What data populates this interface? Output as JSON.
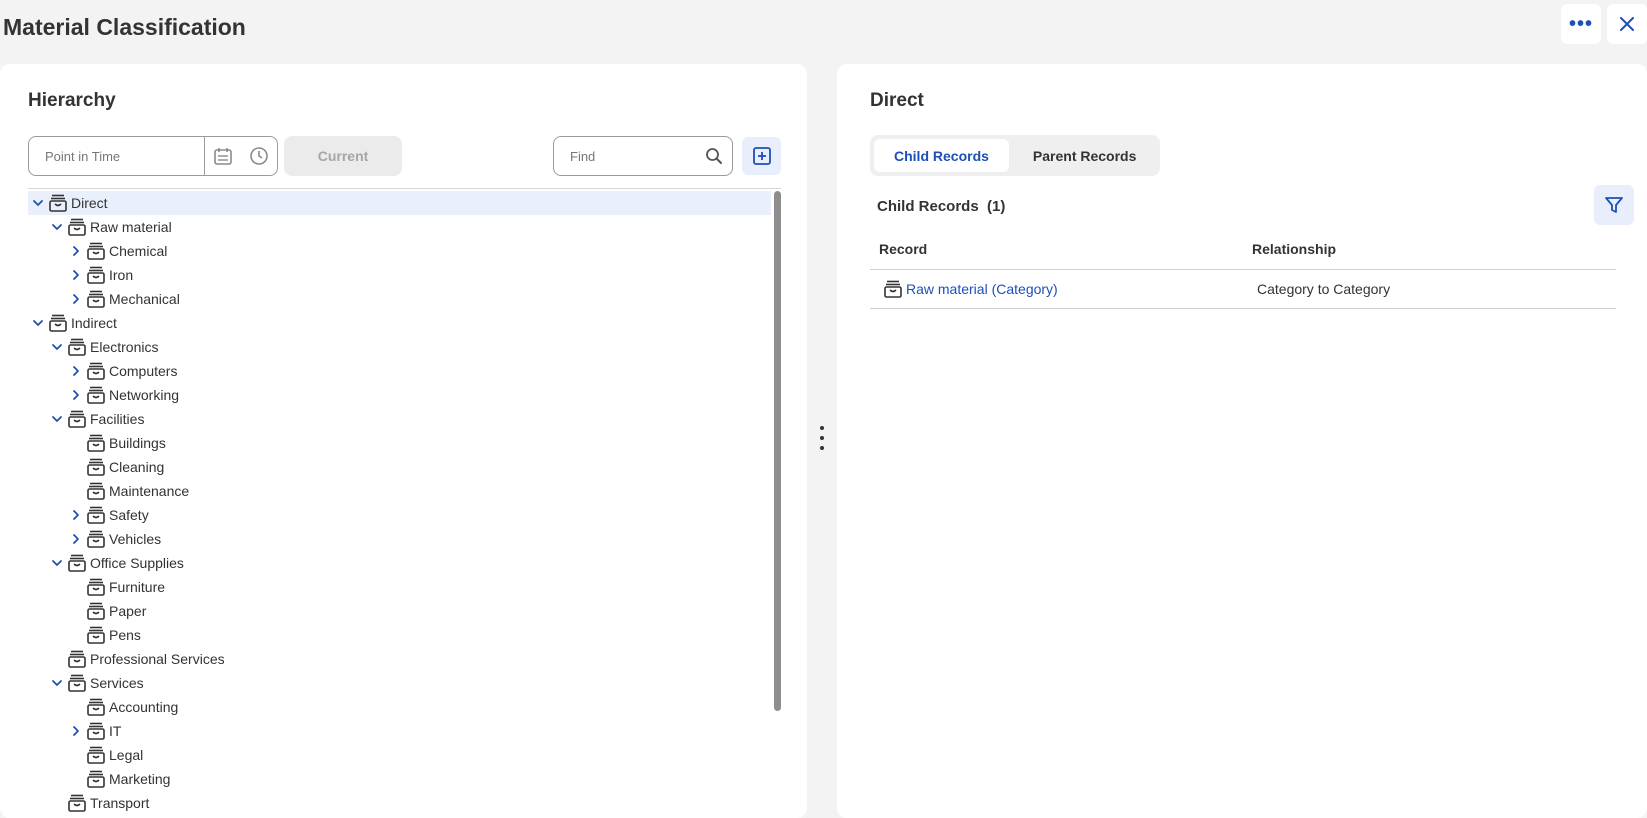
{
  "header": {
    "title": "Material Classification"
  },
  "left_panel": {
    "heading": "Hierarchy",
    "point_in_time_placeholder": "Point in Time",
    "current_label": "Current",
    "find_placeholder": "Find"
  },
  "tree": [
    {
      "label": "Direct",
      "level": 0,
      "expander": "down",
      "selected": true
    },
    {
      "label": "Raw material",
      "level": 1,
      "expander": "down"
    },
    {
      "label": "Chemical",
      "level": 2,
      "expander": "right"
    },
    {
      "label": "Iron",
      "level": 2,
      "expander": "right"
    },
    {
      "label": "Mechanical",
      "level": 2,
      "expander": "right"
    },
    {
      "label": "Indirect",
      "level": 0,
      "expander": "down"
    },
    {
      "label": "Electronics",
      "level": 1,
      "expander": "down"
    },
    {
      "label": "Computers",
      "level": 2,
      "expander": "right"
    },
    {
      "label": "Networking",
      "level": 2,
      "expander": "right"
    },
    {
      "label": "Facilities",
      "level": 1,
      "expander": "down"
    },
    {
      "label": "Buildings",
      "level": 2,
      "expander": "none"
    },
    {
      "label": "Cleaning",
      "level": 2,
      "expander": "none"
    },
    {
      "label": "Maintenance",
      "level": 2,
      "expander": "none"
    },
    {
      "label": "Safety",
      "level": 2,
      "expander": "right"
    },
    {
      "label": "Vehicles",
      "level": 2,
      "expander": "right"
    },
    {
      "label": "Office Supplies",
      "level": 1,
      "expander": "down"
    },
    {
      "label": "Furniture",
      "level": 2,
      "expander": "none"
    },
    {
      "label": "Paper",
      "level": 2,
      "expander": "none"
    },
    {
      "label": "Pens",
      "level": 2,
      "expander": "none"
    },
    {
      "label": "Professional Services",
      "level": 1,
      "expander": "none"
    },
    {
      "label": "Services",
      "level": 1,
      "expander": "down"
    },
    {
      "label": "Accounting",
      "level": 2,
      "expander": "none"
    },
    {
      "label": "IT",
      "level": 2,
      "expander": "right"
    },
    {
      "label": "Legal",
      "level": 2,
      "expander": "none"
    },
    {
      "label": "Marketing",
      "level": 2,
      "expander": "none"
    },
    {
      "label": "Transport",
      "level": 1,
      "expander": "none"
    }
  ],
  "right_panel": {
    "heading": "Direct",
    "tabs": [
      {
        "label": "Child Records",
        "active": true
      },
      {
        "label": "Parent Records",
        "active": false
      }
    ],
    "section_title": "Child Records  (1)",
    "columns": [
      "Record",
      "Relationship"
    ],
    "rows": [
      {
        "record": "Raw material (Category)",
        "relationship": "Category to Category"
      }
    ]
  },
  "icons": {
    "node": "category-box-icon",
    "more": "more-horizontal-icon",
    "close": "close-icon",
    "calendar": "calendar-icon",
    "clock": "clock-icon",
    "search": "search-icon",
    "add": "add-square-icon",
    "filter": "filter-icon"
  },
  "colors": {
    "accent": "#1d4fb8",
    "selected_row": "#e9f0fc",
    "background": "#f3f3f3"
  }
}
